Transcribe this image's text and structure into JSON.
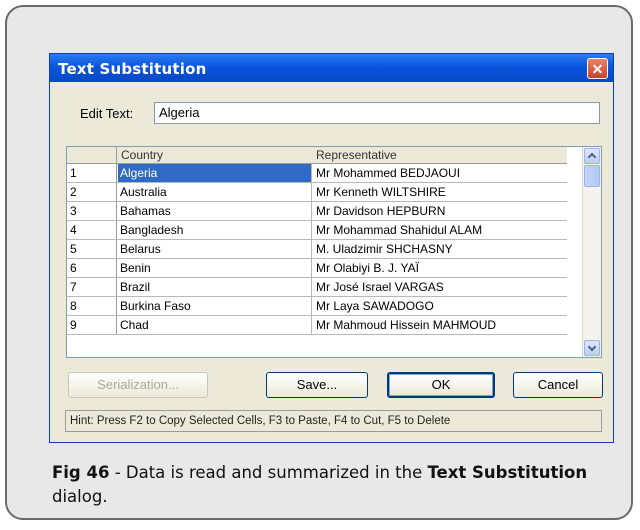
{
  "dialog": {
    "title": "Text Substitution",
    "edit_label": "Edit Text:",
    "edit_value": "Algeria"
  },
  "grid": {
    "columns": [
      "Country",
      "Representative"
    ],
    "rows": [
      {
        "num": "1",
        "country": "Algeria",
        "rep": "Mr Mohammed BEDJAOUI"
      },
      {
        "num": "2",
        "country": "Australia",
        "rep": "Mr Kenneth WILTSHIRE"
      },
      {
        "num": "3",
        "country": "Bahamas",
        "rep": "Mr Davidson HEPBURN"
      },
      {
        "num": "4",
        "country": "Bangladesh",
        "rep": "Mr Mohammad Shahidul ALAM"
      },
      {
        "num": "5",
        "country": "Belarus",
        "rep": "M. Uladzimir SHCHASNY"
      },
      {
        "num": "6",
        "country": "Benin",
        "rep": "Mr Olabiyi B. J. YAÏ"
      },
      {
        "num": "7",
        "country": "Brazil",
        "rep": "Mr José Israel VARGAS"
      },
      {
        "num": "8",
        "country": "Burkina Faso",
        "rep": "Mr Laya SAWADOGO"
      },
      {
        "num": "9",
        "country": "Chad",
        "rep": "Mr Mahmoud Hissein MAHMOUD"
      }
    ]
  },
  "buttons": {
    "serialization": "Serialization...",
    "save": "Save...",
    "ok": "OK",
    "cancel": "Cancel"
  },
  "hint": "Hint: Press F2 to Copy Selected Cells, F3 to Paste, F4 to Cut, F5 to Delete",
  "caption": {
    "fig": "Fig 46",
    "text1": " - Data is read and summarized in the ",
    "bold": "Text Substitution",
    "text2": " dialog."
  },
  "colors": {
    "titlebar": "#0a55dc",
    "selection": "#316ac5",
    "close": "#c9412a"
  }
}
